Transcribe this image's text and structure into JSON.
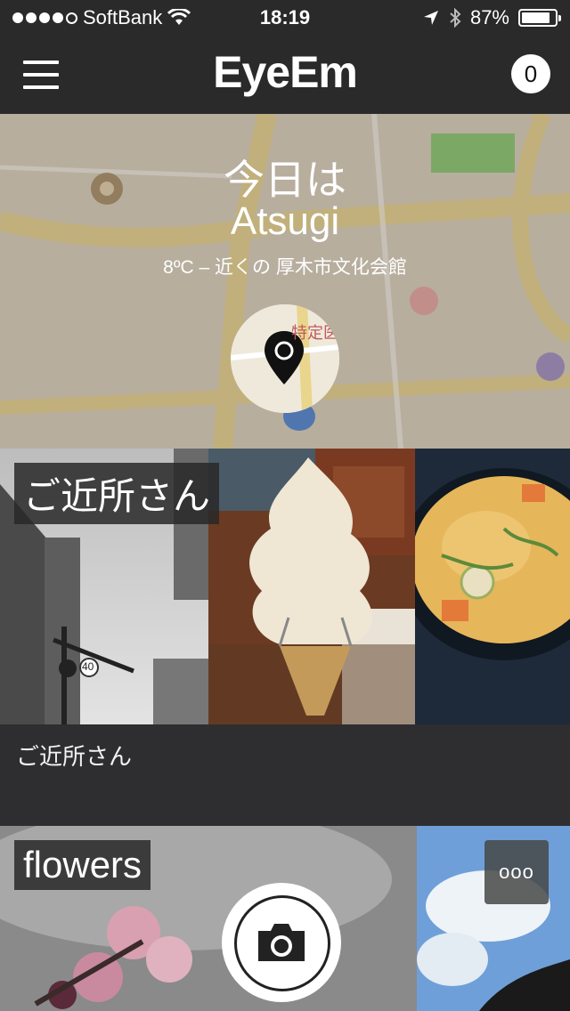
{
  "status_bar": {
    "carrier": "SoftBank",
    "time": "18:19",
    "battery_text": "87%",
    "battery_level": 0.87,
    "icons": [
      "signal-dots",
      "wifi-icon",
      "location-arrow-icon",
      "bluetooth-icon",
      "battery-icon"
    ]
  },
  "nav": {
    "brand": "EyeEm",
    "notification_count": "0"
  },
  "hero": {
    "line1": "今日は",
    "line2": "Atsugi",
    "subtitle": "8ºC – 近くの 厚木市文化会館",
    "map_text": "特定医"
  },
  "albums": [
    {
      "label": "ご近所さん",
      "caption": "ご近所さん",
      "speed_sign": "40"
    },
    {
      "label": "flowers",
      "more_label": "ooo"
    }
  ],
  "colors": {
    "bar": "#2a2a2a",
    "map_road": "#e9d58c",
    "map_park": "#7fc86a",
    "map_bg": "#d9d2c0"
  }
}
